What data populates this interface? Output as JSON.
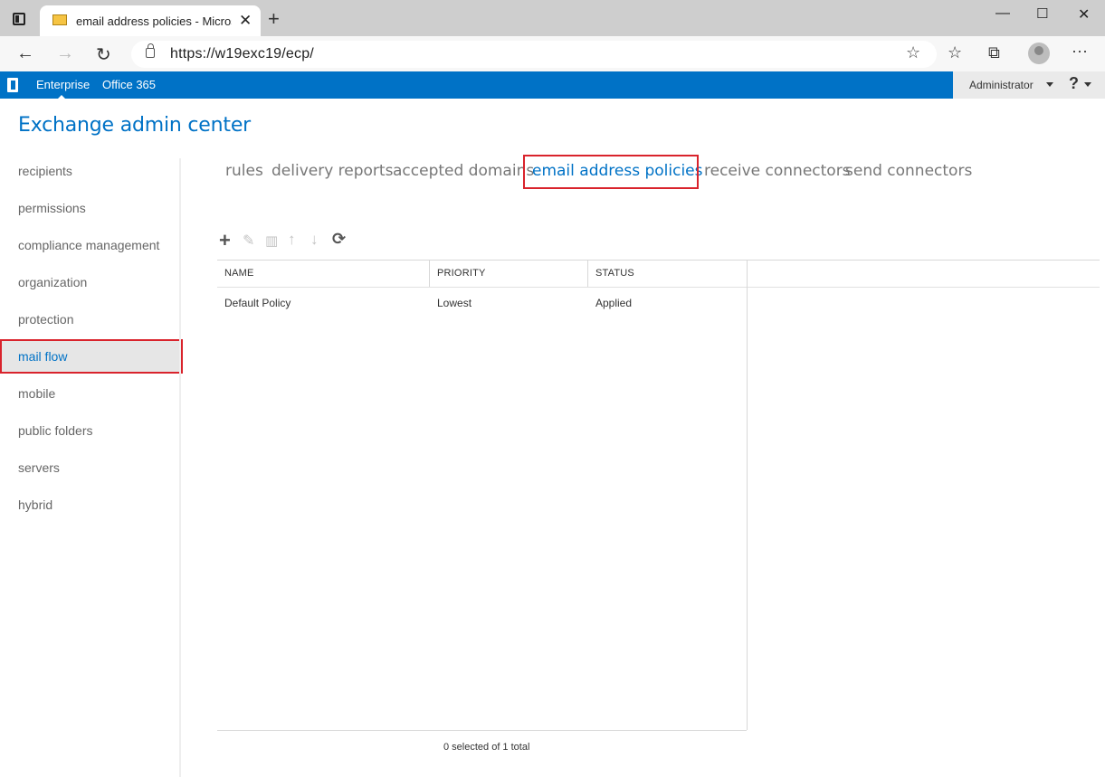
{
  "browser": {
    "tab_title": "email address policies - Microsof",
    "url": "https://w19exc19/ecp/"
  },
  "suite": {
    "links": [
      "Enterprise",
      "Office 365"
    ],
    "user": "Administrator",
    "help": "?"
  },
  "app_title": "Exchange admin center",
  "left_nav": {
    "items": [
      {
        "label": "recipients"
      },
      {
        "label": "permissions"
      },
      {
        "label": "compliance management"
      },
      {
        "label": "organization"
      },
      {
        "label": "protection"
      },
      {
        "label": "mail flow"
      },
      {
        "label": "mobile"
      },
      {
        "label": "public folders"
      },
      {
        "label": "servers"
      },
      {
        "label": "hybrid"
      }
    ],
    "selected": "mail flow"
  },
  "subtabs": {
    "items": [
      {
        "label": "rules"
      },
      {
        "label": "delivery reports"
      },
      {
        "label": "accepted domains"
      },
      {
        "label": "email address policies"
      },
      {
        "label": "receive connectors"
      },
      {
        "label": "send connectors"
      }
    ],
    "selected": "email address policies"
  },
  "toolbar": {
    "icons": [
      "add-icon",
      "edit-icon",
      "delete-icon",
      "move-up-icon",
      "move-down-icon",
      "refresh-icon"
    ]
  },
  "table": {
    "columns": [
      "NAME",
      "PRIORITY",
      "STATUS"
    ],
    "rows": [
      {
        "name": "Default Policy",
        "priority": "Lowest",
        "status": "Applied"
      }
    ],
    "footer": "0 selected of 1 total"
  }
}
